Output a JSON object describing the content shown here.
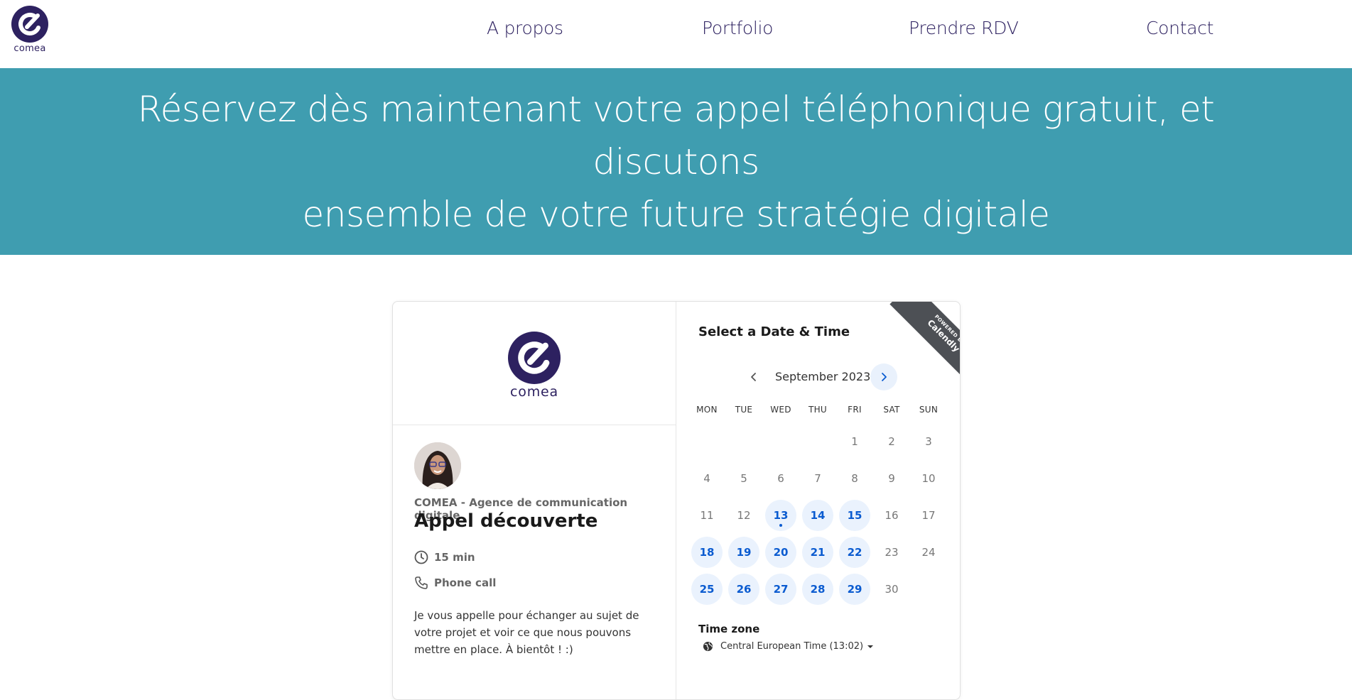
{
  "brand": {
    "name": "comea"
  },
  "nav": {
    "items": [
      {
        "label": "A propos"
      },
      {
        "label": "Portfolio"
      },
      {
        "label": "Prendre RDV"
      },
      {
        "label": "Contact"
      }
    ]
  },
  "hero": {
    "line1": "Réservez dès maintenant votre appel téléphonique gratuit, et discutons",
    "line2": "ensemble de votre future stratégie digitale"
  },
  "event": {
    "brand_wordmark": "comea",
    "organizer": "COMEA - Agence de communication digitale",
    "title": "Appel découverte",
    "duration": "15 min",
    "location": "Phone call",
    "description": "Je vous appelle pour échanger au sujet de votre projet et voir ce que nous pouvons mettre en place. À bientôt ! :)"
  },
  "calendar": {
    "heading": "Select a Date & Time",
    "month": "September 2023",
    "weekdays": [
      "MON",
      "TUE",
      "WED",
      "THU",
      "FRI",
      "SAT",
      "SUN"
    ],
    "days": [
      [
        "",
        "",
        "",
        "",
        "1",
        "2",
        "3"
      ],
      [
        "4",
        "5",
        "6",
        "7",
        "8",
        "9",
        "10"
      ],
      [
        "11",
        "12",
        "13",
        "14",
        "15",
        "16",
        "17"
      ],
      [
        "18",
        "19",
        "20",
        "21",
        "22",
        "23",
        "24"
      ],
      [
        "25",
        "26",
        "27",
        "28",
        "29",
        "30",
        ""
      ]
    ],
    "available": [
      "13",
      "14",
      "15",
      "18",
      "19",
      "20",
      "21",
      "22",
      "25",
      "26",
      "27",
      "28",
      "29"
    ],
    "today": "13",
    "timezone_label": "Time zone",
    "timezone_value": "Central European Time (13:02)"
  },
  "badge": {
    "top": "POWERED BY",
    "name": "Calendly"
  },
  "colors": {
    "brand_purple": "#2d2160",
    "hero_teal": "#3f9db0",
    "accent_blue": "#0a5bd0",
    "available_bg": "#eaf2fd",
    "ribbon": "#4d5055"
  }
}
